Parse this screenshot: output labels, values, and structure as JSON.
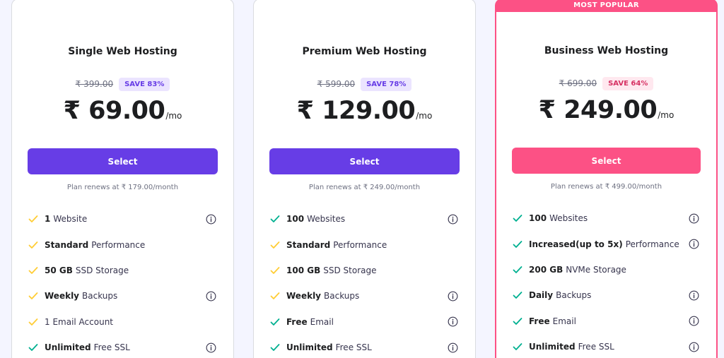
{
  "colors": {
    "check_yellow": "#ffcd35",
    "check_teal": "#00b090",
    "purple": "#673de6",
    "pink": "#fc5185"
  },
  "plans": [
    {
      "title": "Single Web Hosting",
      "old_price": "₹ 399.00",
      "save": "SAVE 83%",
      "price": "₹ 69.00",
      "per": "/mo",
      "select": "Select",
      "renews": "Plan renews at ₹ 179.00/month",
      "features": [
        {
          "bold": "1",
          "text": "Website",
          "check": "yellow",
          "info": true
        },
        {
          "bold": "Standard",
          "text": "Performance",
          "check": "yellow",
          "info": false
        },
        {
          "bold": "50 GB",
          "text": "SSD Storage",
          "check": "yellow",
          "info": false
        },
        {
          "bold": "Weekly",
          "text": "Backups",
          "check": "yellow",
          "info": true
        },
        {
          "bold": "",
          "text": "1 Email Account",
          "check": "yellow",
          "info": false
        },
        {
          "bold": "Unlimited",
          "text": "Free SSL",
          "check": "teal",
          "info": true
        }
      ]
    },
    {
      "title": "Premium Web Hosting",
      "old_price": "₹ 599.00",
      "save": "SAVE 78%",
      "price": "₹ 129.00",
      "per": "/mo",
      "select": "Select",
      "renews": "Plan renews at ₹ 249.00/month",
      "features": [
        {
          "bold": "100",
          "text": "Websites",
          "check": "teal",
          "info": true
        },
        {
          "bold": "Standard",
          "text": "Performance",
          "check": "yellow",
          "info": false
        },
        {
          "bold": "100 GB",
          "text": "SSD Storage",
          "check": "yellow",
          "info": false
        },
        {
          "bold": "Weekly",
          "text": "Backups",
          "check": "yellow",
          "info": true
        },
        {
          "bold": "Free",
          "text": "Email",
          "check": "teal",
          "info": true
        },
        {
          "bold": "Unlimited",
          "text": "Free SSL",
          "check": "teal",
          "info": true
        }
      ]
    },
    {
      "badge": "MOST POPULAR",
      "title": "Business Web Hosting",
      "old_price": "₹ 699.00",
      "save": "SAVE 64%",
      "price": "₹ 249.00",
      "per": "/mo",
      "select": "Select",
      "renews": "Plan renews at ₹ 499.00/month",
      "features": [
        {
          "bold": "100",
          "text": "Websites",
          "check": "teal",
          "info": true
        },
        {
          "bold": "Increased(up to 5x)",
          "text": "Performance",
          "check": "teal",
          "info": true
        },
        {
          "bold": "200 GB",
          "text": "NVMe Storage",
          "check": "teal",
          "info": false
        },
        {
          "bold": "Daily",
          "text": "Backups",
          "check": "teal",
          "info": true
        },
        {
          "bold": "Free",
          "text": "Email",
          "check": "teal",
          "info": true
        },
        {
          "bold": "Unlimited",
          "text": "Free SSL",
          "check": "teal",
          "info": true
        }
      ]
    }
  ]
}
